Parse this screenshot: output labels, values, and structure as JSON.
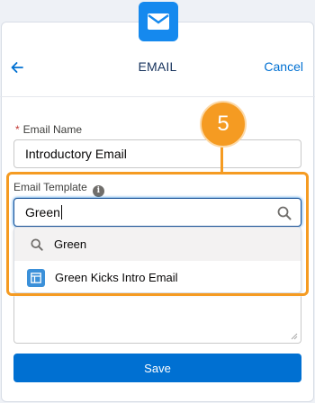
{
  "header": {
    "title": "EMAIL",
    "cancel_label": "Cancel",
    "icon": "envelope-icon",
    "back_icon": "arrow-left-icon"
  },
  "form": {
    "email_name": {
      "required_mark": "*",
      "label": "Email Name",
      "value": "Introductory Email"
    },
    "email_template": {
      "label": "Email Template",
      "info_icon": "info-icon",
      "search_value": "Green",
      "search_icon": "search-icon"
    },
    "dropdown": {
      "items": [
        {
          "icon": "search-icon",
          "label": "Green"
        },
        {
          "icon": "email-template-icon",
          "label": "Green Kicks Intro Email"
        }
      ]
    },
    "save_label": "Save"
  },
  "callout": {
    "step_number": "5"
  },
  "colors": {
    "brand": "#0070d2",
    "header_icon_bg": "#1589ee",
    "callout": "#f59b22",
    "required": "#c23934",
    "template_icon_bg": "#3b90d9"
  }
}
